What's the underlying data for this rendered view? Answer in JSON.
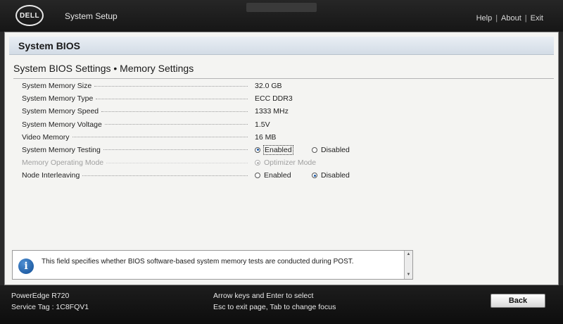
{
  "header": {
    "logo_text": "DELL",
    "title": "System Setup",
    "links": [
      "Help",
      "About",
      "Exit"
    ],
    "separator": "|"
  },
  "section": {
    "title": "System BIOS"
  },
  "page": {
    "title": "System BIOS Settings • Memory Settings"
  },
  "settings": {
    "memory_size": {
      "label": "System Memory Size",
      "value": "32.0 GB"
    },
    "memory_type": {
      "label": "System Memory Type",
      "value": "ECC DDR3"
    },
    "memory_speed": {
      "label": "System Memory Speed",
      "value": "1333 MHz"
    },
    "memory_voltage": {
      "label": "System Memory Voltage",
      "value": "1.5V"
    },
    "video_memory": {
      "label": "Video Memory",
      "value": "16 MB"
    },
    "memory_testing": {
      "label": "System Memory Testing",
      "options": [
        "Enabled",
        "Disabled"
      ],
      "selected": "Enabled"
    },
    "operating_mode": {
      "label": "Memory Operating Mode",
      "options": [
        "Optimizer Mode"
      ],
      "selected": "Optimizer Mode",
      "disabled": true
    },
    "node_interleaving": {
      "label": "Node Interleaving",
      "options": [
        "Enabled",
        "Disabled"
      ],
      "selected": "Disabled"
    }
  },
  "help": {
    "text": "This field specifies whether BIOS software-based system memory tests are conducted during POST."
  },
  "footer": {
    "model": "PowerEdge R720",
    "service_tag": "Service Tag : 1C8FQV1",
    "hint_1": "Arrow keys and Enter to select",
    "hint_2": "Esc to exit page, Tab to change focus",
    "back_label": "Back"
  },
  "colors": {
    "header_bg": "#1e1e1e",
    "panel_bg": "#f4f4f2",
    "section_bar": "#dde4ec",
    "radio_selected": "#1b5aa6",
    "info_icon": "#2a6cb5"
  },
  "icons": {
    "help": "info-icon",
    "logo": "dell-logo"
  }
}
